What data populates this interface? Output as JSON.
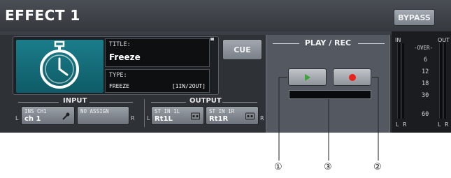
{
  "window": {
    "title": "EFFECT 1",
    "bypass_label": "BYPASS"
  },
  "effect": {
    "title_label": "TITLE:",
    "title_value": "Freeze",
    "type_label": "TYPE:",
    "type_value": "FREEZE",
    "type_io": "[1IN/2OUT]",
    "icon": "stopwatch-icon"
  },
  "cue_label": "CUE",
  "input": {
    "label": "INPUT",
    "left_marker": "L",
    "right_marker": "R",
    "buttons": [
      {
        "line1": "INS CH1",
        "line2": "ch 1",
        "icon": "microphone-icon"
      },
      {
        "line1": "NO ASSIGN",
        "line2": ""
      }
    ]
  },
  "output": {
    "label": "OUTPUT",
    "left_marker": "L",
    "right_marker": "R",
    "buttons": [
      {
        "line1": "ST IN 1L",
        "line2": "Rt1L",
        "icon": "tape-icon"
      },
      {
        "line1": "ST IN 1R",
        "line2": "Rt1R",
        "icon": "tape-icon"
      }
    ]
  },
  "play_rec": {
    "label": "PLAY / REC",
    "play_icon": "play-icon",
    "rec_icon": "record-icon"
  },
  "meter": {
    "in_label": "IN",
    "out_label": "OUT",
    "scale": [
      "-OVER-",
      "6",
      "12",
      "18",
      "30",
      "60"
    ],
    "channels_in": [
      "L",
      "R"
    ],
    "channels_out": [
      "L",
      "R"
    ]
  },
  "callouts": [
    "①",
    "③",
    "②"
  ],
  "colors": {
    "play": "#3fa23a",
    "record": "#e8231d",
    "logo_bg": "#137080"
  }
}
